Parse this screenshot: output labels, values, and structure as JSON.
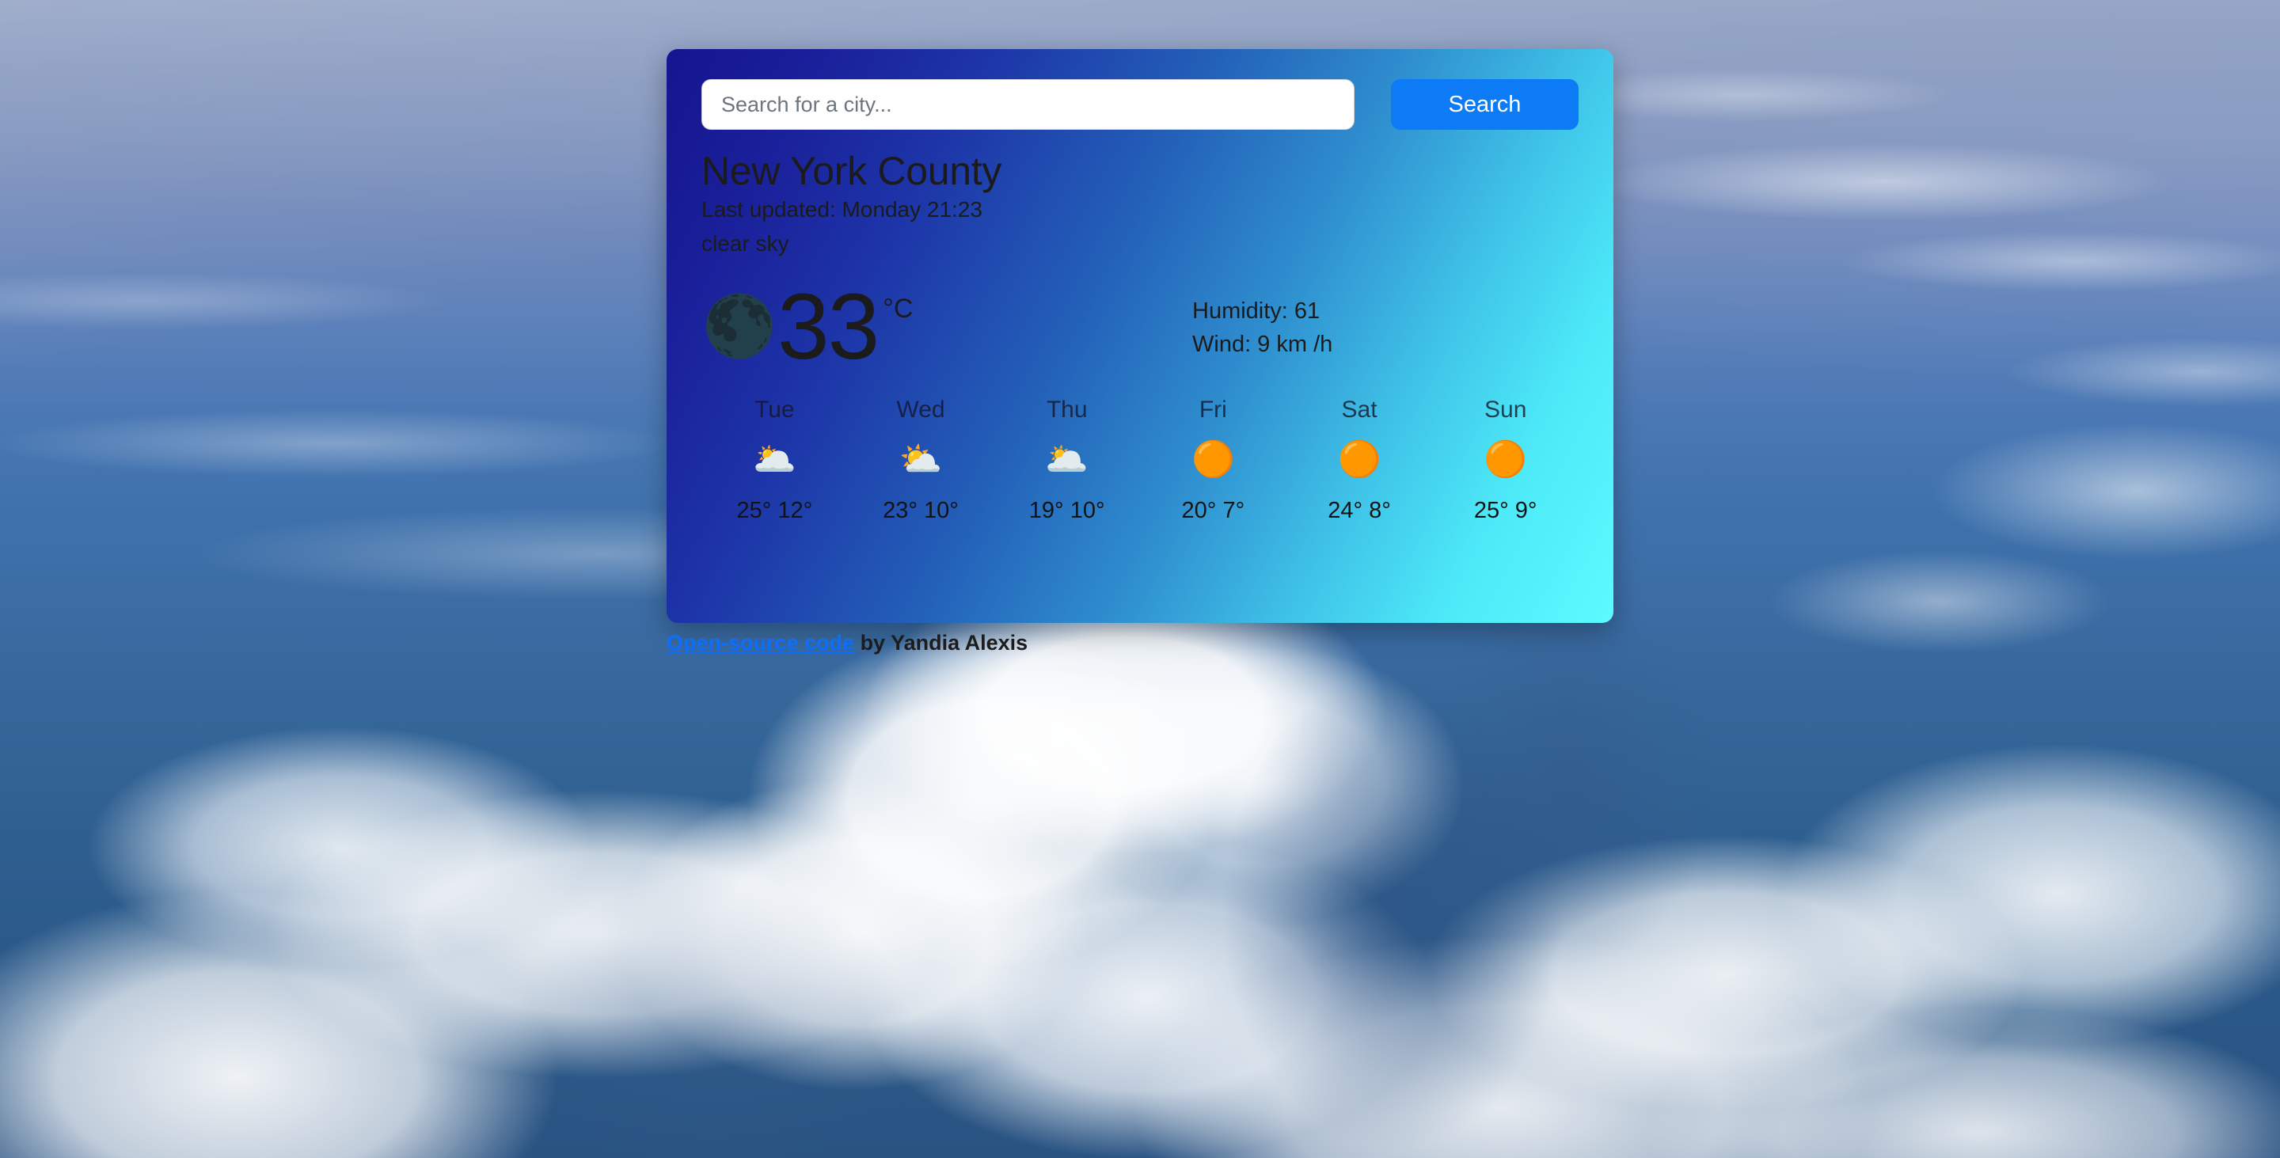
{
  "search": {
    "placeholder": "Search for a city...",
    "value": "",
    "button_label": "Search"
  },
  "location": {
    "city": "New York County",
    "last_updated": "Last updated: Monday 21:23",
    "description": "clear sky"
  },
  "current": {
    "icon": "new-moon-icon",
    "icon_glyph": "🌑",
    "temperature": "33",
    "unit": "°C",
    "humidity": "Humidity: 61",
    "wind": "Wind: 9 km /h"
  },
  "forecast": [
    {
      "day": "Tue",
      "icon": "cloud-icon",
      "icon_glyph": "🌥️",
      "temps": "25° 12°"
    },
    {
      "day": "Wed",
      "icon": "sun-behind-cloud-icon",
      "icon_glyph": "⛅",
      "temps": "23° 10°"
    },
    {
      "day": "Thu",
      "icon": "cloud-icon",
      "icon_glyph": "🌥️",
      "temps": "19° 10°"
    },
    {
      "day": "Fri",
      "icon": "sun-icon",
      "icon_glyph": "🟠",
      "temps": "20° 7°"
    },
    {
      "day": "Sat",
      "icon": "sun-icon",
      "icon_glyph": "🟠",
      "temps": "24° 8°"
    },
    {
      "day": "Sun",
      "icon": "sun-icon",
      "icon_glyph": "🟠",
      "temps": "25° 9°"
    }
  ],
  "footer": {
    "link_label": "Open-source code",
    "credit": " by Yandia Alexis"
  },
  "colors": {
    "card_gradient_start": "#15158f",
    "card_gradient_end": "#5cfbff",
    "search_button": "#0d7bf5",
    "link": "#0d6efd",
    "text_dark": "#1b1b1b",
    "placeholder": "#6c757d"
  }
}
